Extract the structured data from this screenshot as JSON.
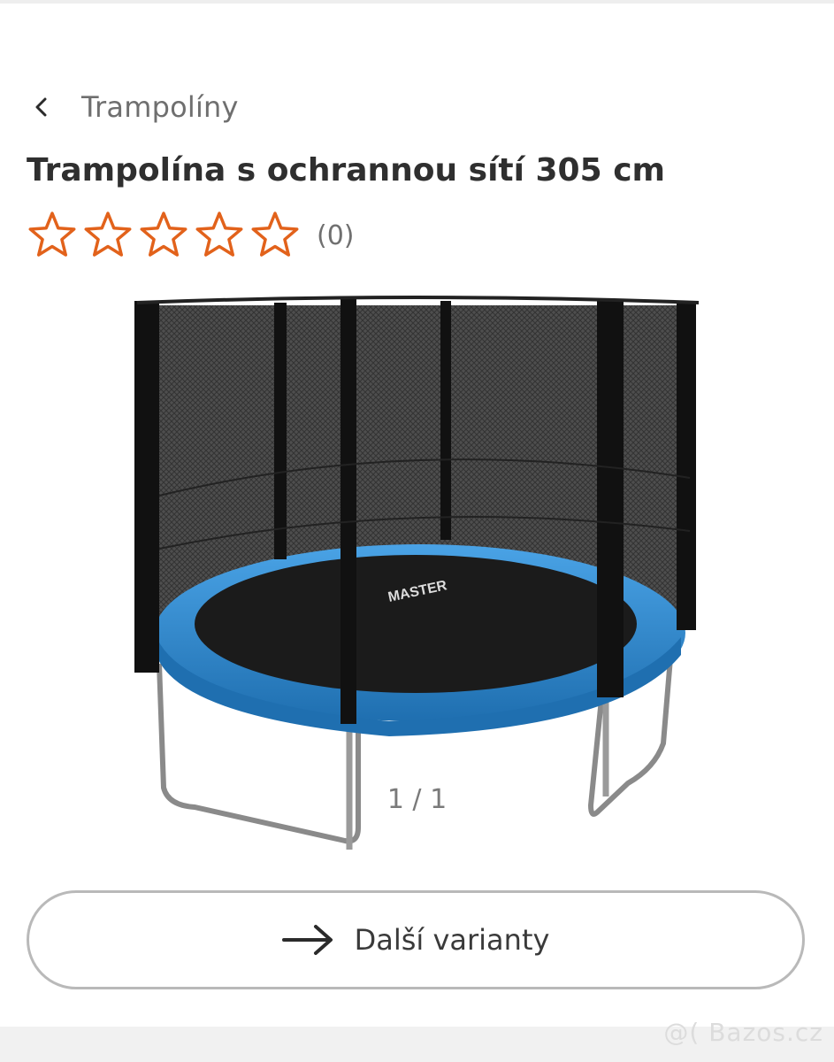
{
  "breadcrumb": {
    "label": "Trampolíny"
  },
  "product": {
    "title": "Trampolína s ochrannou sítí 305 cm",
    "rating": {
      "value": 0,
      "max": 5,
      "count_label": "(0)",
      "star_color": "#e2621b"
    }
  },
  "gallery": {
    "counter": "1 / 1"
  },
  "variants_button": {
    "label": "Další varianty"
  },
  "watermark": {
    "text": "@( Bazos.cz"
  },
  "colors": {
    "accent_star": "#e2621b",
    "trampoline_pad": "#2f86c9",
    "net": "#1f1f1f"
  }
}
